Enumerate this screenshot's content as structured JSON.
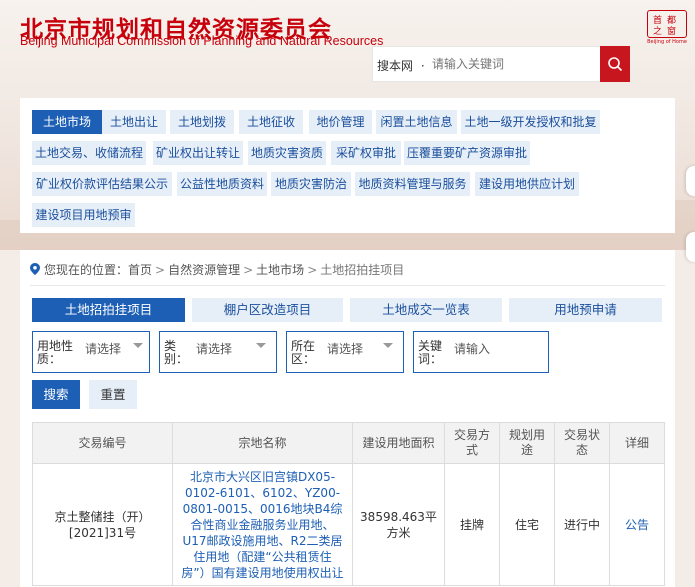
{
  "header": {
    "title": "北京市规划和自然资源委员会",
    "subtitle": "Beijing Municipal Commission of Planning and Natural Resources",
    "logo": {
      "chars": [
        "首",
        "都",
        "之",
        "窗"
      ],
      "caption": "Beijing of Home"
    },
    "search": {
      "scope": "搜本网",
      "placeholder": "请输入关键词",
      "icon": "search-icon"
    }
  },
  "nav": {
    "items": [
      "土地市场",
      "土地出让",
      "土地划拨",
      "土地征收",
      "地价管理",
      "闲置土地信息",
      "土地一级开发授权和批复",
      "土地交易、收储流程",
      "矿业权出让转让",
      "地质灾害资质",
      "采矿权审批",
      "压覆重要矿产资源审批",
      "矿业权价款评估结果公示",
      "公益性地质资料",
      "地质灾害防治",
      "地质资料管理与服务",
      "建设用地供应计划",
      "建设项目用地预审"
    ],
    "active_index": 0
  },
  "breadcrumb": {
    "prefix": "您现在的位置：",
    "items": [
      "首页",
      "自然资源管理",
      "土地市场",
      "土地招拍挂项目"
    ]
  },
  "tabs": [
    "土地招拍挂项目",
    "棚户区改造项目",
    "土地成交一览表",
    "用地预申请"
  ],
  "filters": [
    {
      "label1": "用地性",
      "label2": "质：",
      "value": "请选择"
    },
    {
      "label1": "类",
      "label2": "别：",
      "value": "请选择"
    },
    {
      "label1": "所在",
      "label2": "区：",
      "value": "请选择"
    },
    {
      "label1": "关键",
      "label2": "词：",
      "value": "请输入"
    }
  ],
  "buttons": {
    "search": "搜索",
    "reset": "重置"
  },
  "table": {
    "headers": [
      [
        "交易编号"
      ],
      [
        "宗地名称"
      ],
      [
        "建设用地面积"
      ],
      [
        "交易方",
        "式"
      ],
      [
        "规划用",
        "途"
      ],
      [
        "交易状",
        "态"
      ],
      [
        "详细"
      ]
    ],
    "rows": [
      {
        "code": [
          "京土整储挂（开）",
          "[2021]31号"
        ],
        "name": [
          "北京市大兴区旧宫镇DX05-",
          "0102-6101、6102、YZ00-",
          "0801-0015、0016地块B4综",
          "合性商业金融服务业用地、",
          "U17邮政设施用地、R2二类居",
          "住用地（配建“公共租赁住",
          "房”）国有建设用地使用权出让"
        ],
        "area": [
          "38598.463平",
          "方米"
        ],
        "method": "挂牌",
        "usage": "住宅",
        "status": "进行中",
        "detail": "公告"
      }
    ]
  },
  "colors": {
    "brand_red": "#c7000b",
    "accent_blue": "#1d5fb5",
    "tab_bg": "#e6eef8"
  }
}
